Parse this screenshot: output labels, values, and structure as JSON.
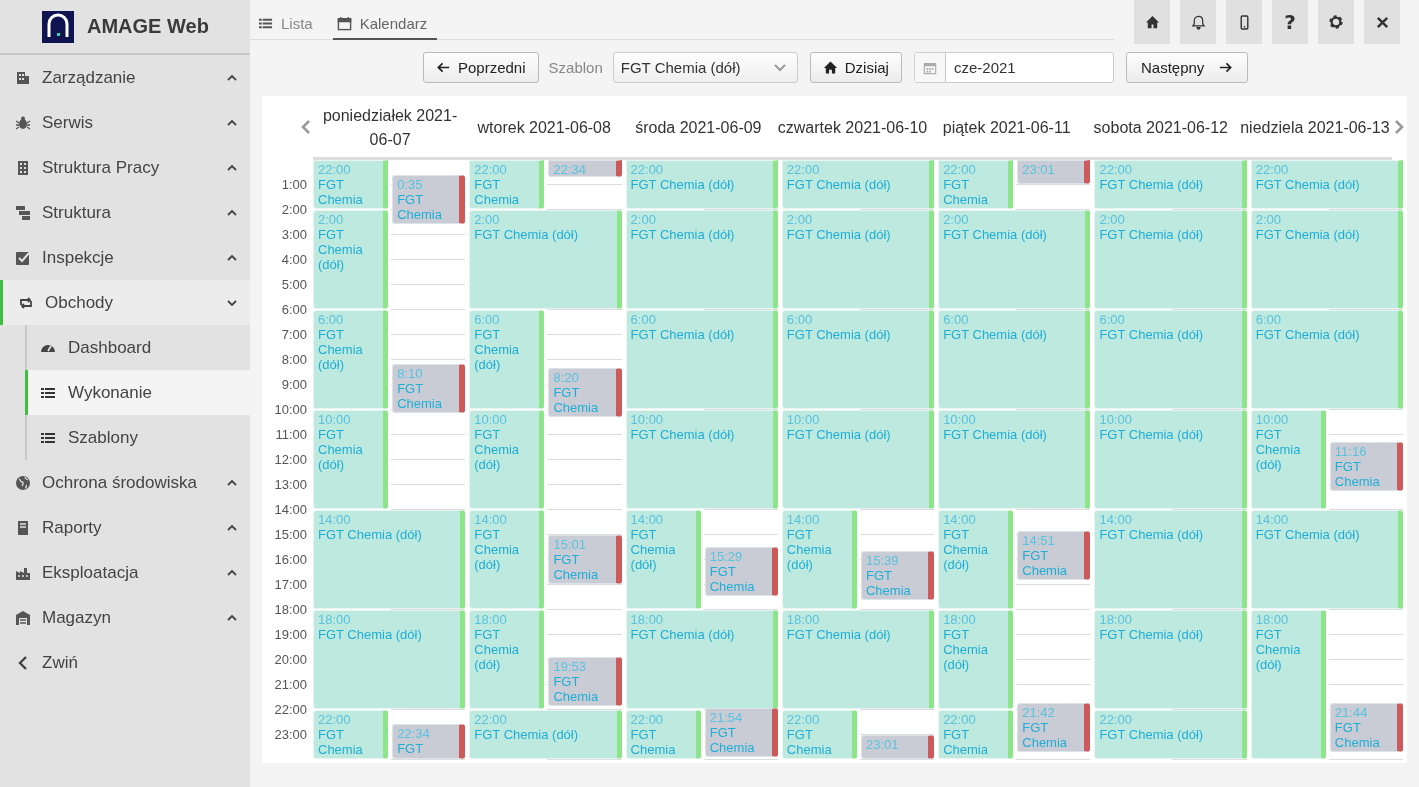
{
  "app": {
    "name": "AMAGE Web"
  },
  "sidebar": {
    "items": [
      {
        "label": "Zarządzanie",
        "expanded": false,
        "selected": false
      },
      {
        "label": "Serwis",
        "expanded": false,
        "selected": false
      },
      {
        "label": "Struktura Pracy",
        "expanded": false,
        "selected": false
      },
      {
        "label": "Struktura",
        "expanded": false,
        "selected": false
      },
      {
        "label": "Inspekcje",
        "expanded": false,
        "selected": false
      },
      {
        "label": "Obchody",
        "expanded": true,
        "selected": true,
        "children": [
          {
            "label": "Dashboard",
            "selected": false
          },
          {
            "label": "Wykonanie",
            "selected": true
          },
          {
            "label": "Szablony",
            "selected": false
          }
        ]
      },
      {
        "label": "Ochrona środowiska",
        "expanded": false,
        "selected": false
      },
      {
        "label": "Raporty",
        "expanded": false,
        "selected": false
      },
      {
        "label": "Eksploatacja",
        "expanded": false,
        "selected": false
      },
      {
        "label": "Magazyn",
        "expanded": false,
        "selected": false
      }
    ],
    "collapse": "Zwiń"
  },
  "tabs": [
    {
      "label": "Lista",
      "selected": false
    },
    {
      "label": "Kalendarz",
      "selected": true
    }
  ],
  "top_buttons": {
    "help": "?"
  },
  "toolbar": {
    "previous": "Poprzedni",
    "template_label": "Szablon",
    "template": "FGT Chemia (dół)",
    "today": "Dzisiaj",
    "month": "cze-2021",
    "next": "Następny"
  },
  "calendar": {
    "time_axis": [
      "1:00",
      "2:00",
      "3:00",
      "4:00",
      "5:00",
      "6:00",
      "7:00",
      "8:00",
      "9:00",
      "10:00",
      "11:00",
      "12:00",
      "13:00",
      "14:00",
      "15:00",
      "16:00",
      "17:00",
      "18:00",
      "19:00",
      "20:00",
      "21:00",
      "22:00",
      "23:00"
    ],
    "days": [
      {
        "label": "poniedziałek 2021-06-07",
        "events": [
          {
            "kind": "planned",
            "time": "22:00",
            "title": "FGT Chemia"
          },
          {
            "kind": "done",
            "time": "0:35",
            "title": "FGT Chemia"
          },
          {
            "kind": "planned",
            "time": "2:00",
            "title": "FGT Chemia (dół)"
          },
          {
            "kind": "planned",
            "time": "6:00",
            "title": "FGT Chemia (dół)"
          },
          {
            "kind": "done",
            "time": "8:10",
            "title": "FGT Chemia"
          },
          {
            "kind": "planned",
            "time": "10:00",
            "title": "FGT Chemia (dół)"
          },
          {
            "kind": "planned",
            "time": "14:00",
            "title": "FGT Chemia (dół)"
          },
          {
            "kind": "planned",
            "time": "18:00",
            "title": "FGT Chemia (dół)"
          },
          {
            "kind": "planned",
            "time": "22:00",
            "title": "FGT Chemia"
          },
          {
            "kind": "done",
            "time": "22:34",
            "title": "FGT"
          }
        ]
      },
      {
        "label": "wtorek 2021-06-08",
        "events": [
          {
            "kind": "planned",
            "time": "22:00",
            "title": "FGT Chemia"
          },
          {
            "kind": "done",
            "time": "22:34"
          },
          {
            "kind": "planned",
            "time": "2:00",
            "title": "FGT Chemia (dół)"
          },
          {
            "kind": "planned",
            "time": "6:00",
            "title": "FGT Chemia (dół)"
          },
          {
            "kind": "done",
            "time": "8:20",
            "title": "FGT Chemia"
          },
          {
            "kind": "planned",
            "time": "10:00",
            "title": "FGT Chemia (dół)"
          },
          {
            "kind": "planned",
            "time": "14:00",
            "title": "FGT Chemia (dół)"
          },
          {
            "kind": "done",
            "time": "15:01",
            "title": "FGT Chemia"
          },
          {
            "kind": "planned",
            "time": "18:00",
            "title": "FGT Chemia (dół)"
          },
          {
            "kind": "done",
            "time": "19:53",
            "title": "FGT Chemia"
          },
          {
            "kind": "planned",
            "time": "22:00",
            "title": "FGT Chemia (dół)"
          }
        ]
      },
      {
        "label": "środa 2021-06-09",
        "events": [
          {
            "kind": "planned",
            "time": "22:00",
            "title": "FGT Chemia (dół)"
          },
          {
            "kind": "planned",
            "time": "2:00",
            "title": "FGT Chemia (dół)"
          },
          {
            "kind": "planned",
            "time": "6:00",
            "title": "FGT Chemia (dół)"
          },
          {
            "kind": "planned",
            "time": "10:00",
            "title": "FGT Chemia (dół)"
          },
          {
            "kind": "planned",
            "time": "14:00",
            "title": "FGT Chemia (dół)"
          },
          {
            "kind": "done",
            "time": "15:29",
            "title": "FGT Chemia"
          },
          {
            "kind": "planned",
            "time": "18:00",
            "title": "FGT Chemia (dół)"
          },
          {
            "kind": "planned",
            "time": "22:00",
            "title": "FGT Chemia"
          },
          {
            "kind": "done",
            "time": "21:54",
            "title": "FGT Chemia"
          }
        ]
      },
      {
        "label": "czwartek 2021-06-10",
        "events": [
          {
            "kind": "planned",
            "time": "22:00",
            "title": "FGT Chemia (dół)"
          },
          {
            "kind": "planned",
            "time": "2:00",
            "title": "FGT Chemia (dół)"
          },
          {
            "kind": "planned",
            "time": "6:00",
            "title": "FGT Chemia (dół)"
          },
          {
            "kind": "planned",
            "time": "10:00",
            "title": "FGT Chemia (dół)"
          },
          {
            "kind": "planned",
            "time": "14:00",
            "title": "FGT Chemia (dół)"
          },
          {
            "kind": "done",
            "time": "15:39",
            "title": "FGT Chemia"
          },
          {
            "kind": "planned",
            "time": "18:00",
            "title": "FGT Chemia (dół)"
          },
          {
            "kind": "planned",
            "time": "22:00",
            "title": "FGT Chemia"
          },
          {
            "kind": "done",
            "time": "23:01"
          }
        ]
      },
      {
        "label": "piątek 2021-06-11",
        "events": [
          {
            "kind": "planned",
            "time": "22:00",
            "title": "FGT Chemia"
          },
          {
            "kind": "done",
            "time": "23:01"
          },
          {
            "kind": "planned",
            "time": "2:00",
            "title": "FGT Chemia (dół)"
          },
          {
            "kind": "planned",
            "time": "6:00",
            "title": "FGT Chemia (dół)"
          },
          {
            "kind": "planned",
            "time": "10:00",
            "title": "FGT Chemia (dół)"
          },
          {
            "kind": "planned",
            "time": "14:00",
            "title": "FGT Chemia (dół)"
          },
          {
            "kind": "done",
            "time": "14:51",
            "title": "FGT Chemia"
          },
          {
            "kind": "planned",
            "time": "18:00",
            "title": "FGT Chemia (dół)"
          },
          {
            "kind": "planned",
            "time": "22:00",
            "title": "FGT Chemia"
          },
          {
            "kind": "done",
            "time": "21:42",
            "title": "FGT Chemia"
          }
        ]
      },
      {
        "label": "sobota 2021-06-12",
        "events": [
          {
            "kind": "planned",
            "time": "22:00",
            "title": "FGT Chemia (dół)"
          },
          {
            "kind": "planned",
            "time": "2:00",
            "title": "FGT Chemia (dół)"
          },
          {
            "kind": "planned",
            "time": "6:00",
            "title": "FGT Chemia (dół)"
          },
          {
            "kind": "planned",
            "time": "10:00",
            "title": "FGT Chemia (dół)"
          },
          {
            "kind": "planned",
            "time": "14:00",
            "title": "FGT Chemia (dół)"
          },
          {
            "kind": "planned",
            "time": "18:00",
            "title": "FGT Chemia (dół)"
          },
          {
            "kind": "planned",
            "time": "22:00",
            "title": "FGT Chemia (dół)"
          }
        ]
      },
      {
        "label": "niedziela 2021-06-13",
        "events": [
          {
            "kind": "planned",
            "time": "22:00",
            "title": "FGT Chemia (dół)"
          },
          {
            "kind": "planned",
            "time": "2:00",
            "title": "FGT Chemia (dół)"
          },
          {
            "kind": "planned",
            "time": "6:00",
            "title": "FGT Chemia (dół)"
          },
          {
            "kind": "planned",
            "time": "10:00",
            "title": "FGT Chemia (dół)"
          },
          {
            "kind": "done",
            "time": "11:16",
            "title": "FGT Chemia"
          },
          {
            "kind": "planned",
            "time": "14:00",
            "title": "FGT Chemia (dół)"
          },
          {
            "kind": "planned",
            "time": "18:00",
            "title": "FGT Chemia (dół)"
          },
          {
            "kind": "done",
            "time": "21:44",
            "title": "FGT Chemia"
          }
        ]
      }
    ]
  }
}
